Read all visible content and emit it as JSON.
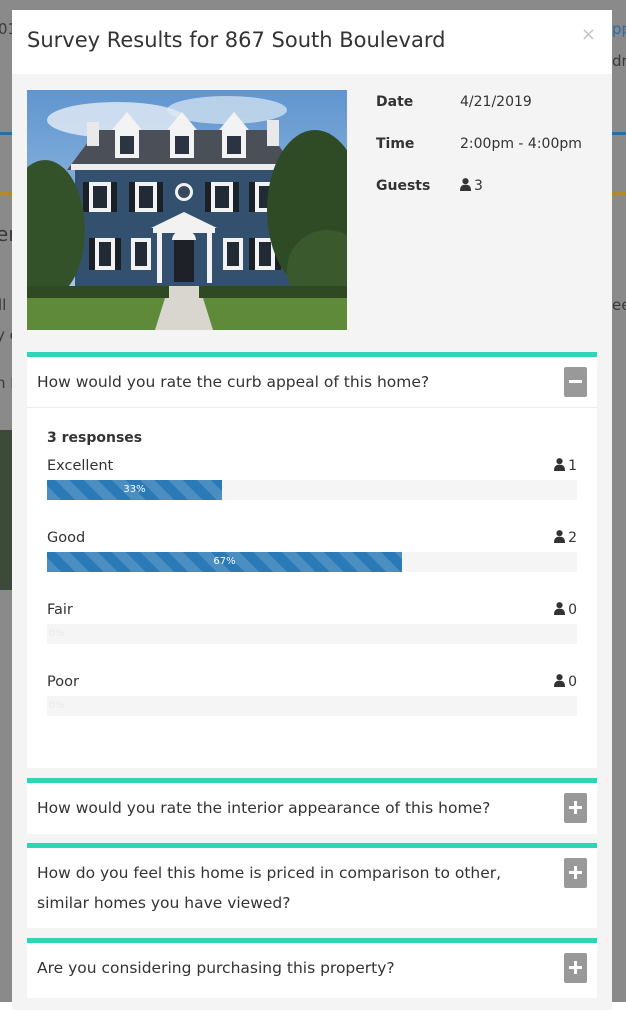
{
  "modal": {
    "title": "Survey Results for 867 South Boulevard",
    "close_label": "×"
  },
  "listing": {
    "date_label": "Date",
    "date_value": "4/21/2019",
    "time_label": "Time",
    "time_value": "2:00pm - 4:00pm",
    "guests_label": "Guests",
    "guests_value": "3"
  },
  "questions": [
    {
      "text": "How would you rate the curb appeal of this home?",
      "expanded": true,
      "responses_label": "3 responses",
      "answers": [
        {
          "label": "Excellent",
          "count": "1",
          "percent": 33,
          "percent_label": "33%"
        },
        {
          "label": "Good",
          "count": "2",
          "percent": 67,
          "percent_label": "67%"
        },
        {
          "label": "Fair",
          "count": "0",
          "percent": 0,
          "percent_label": "0%"
        },
        {
          "label": "Poor",
          "count": "0",
          "percent": 0,
          "percent_label": "0%"
        }
      ]
    },
    {
      "text": "How would you rate the interior appearance of this home?",
      "expanded": false
    },
    {
      "text": "How do you feel this home is priced in comparison to other, similar homes you have viewed?",
      "expanded": false
    },
    {
      "text": "Are you considering purchasing this property?",
      "expanded": false
    }
  ],
  "background": {
    "frag_1": "01",
    "frag_2": "pp",
    "frag_3": "dr",
    "frag_4": "er",
    "frag_5": "ll",
    "frag_6": "y c",
    "frag_7": "n E",
    "frag_8": "ee"
  },
  "colors": {
    "accent": "#2ed5b4",
    "bar": "#2a7ab7",
    "toggle": "#999999"
  }
}
